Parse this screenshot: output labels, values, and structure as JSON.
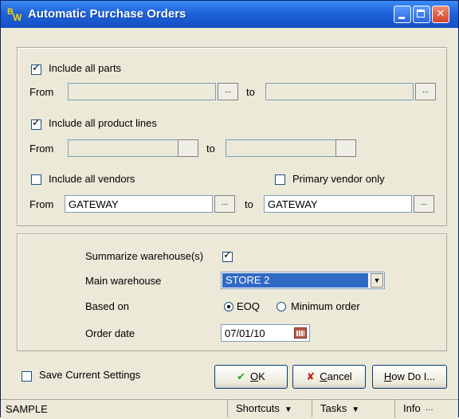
{
  "window": {
    "title": "Automatic Purchase Orders",
    "icon_b": "B",
    "icon_w": "W",
    "controls": [
      "minimize-icon",
      "maximize-icon",
      "close-icon"
    ],
    "close_glyph": "✕"
  },
  "filters": {
    "parts": {
      "label": "Include all parts",
      "checked": true,
      "from_label": "From",
      "to_label": "to",
      "from": "",
      "to": ""
    },
    "product_lines": {
      "label": "Include all product lines",
      "checked": true,
      "from_label": "From",
      "to_label": "to",
      "from": "",
      "to": ""
    },
    "vendors": {
      "label": "Include all vendors",
      "checked": false,
      "from_label": "From",
      "to_label": "to",
      "from": "GATEWAY",
      "to": "GATEWAY"
    },
    "primary_vendor": {
      "label": "Primary vendor only",
      "checked": false
    },
    "ellipsis": "..."
  },
  "options": {
    "summarize_label": "Summarize warehouse(s)",
    "summarize_checked": true,
    "main_warehouse_label": "Main warehouse",
    "main_warehouse_value": "STORE 2",
    "based_on_label": "Based on",
    "based_on_options": [
      "EOQ",
      "Minimum order"
    ],
    "based_on_selected": "EOQ",
    "order_date_label": "Order date",
    "order_date_value": "07/01/10"
  },
  "footer": {
    "save_settings_label": "Save Current Settings",
    "save_settings_checked": false,
    "ok_label": "OK",
    "ok_first": "O",
    "ok_rest": "K",
    "cancel_label": "Cancel",
    "cancel_first": "C",
    "cancel_rest": "ancel",
    "howdo_first": "H",
    "howdo_rest": "ow Do I...",
    "ok_glyph": "✔",
    "cancel_glyph": "✘"
  },
  "statusbar": {
    "left": "SAMPLE",
    "shortcuts": "Shortcuts",
    "tasks": "Tasks",
    "info": "Info",
    "dropdown_glyph": "▼",
    "more_glyph": "···"
  }
}
